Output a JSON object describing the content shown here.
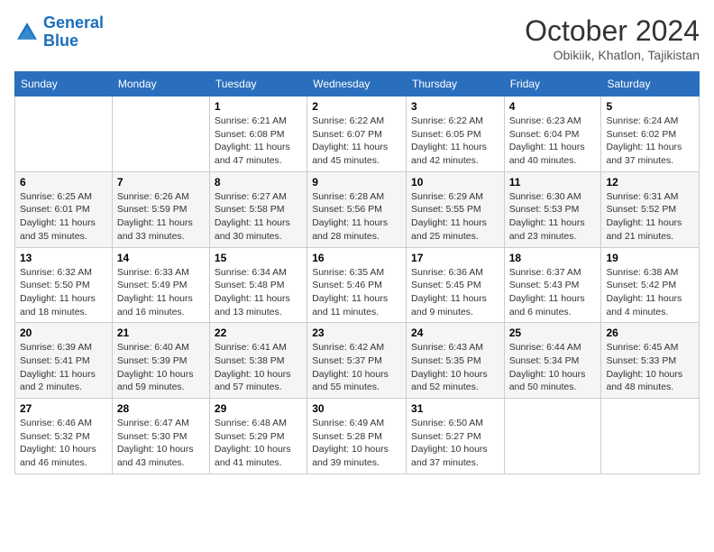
{
  "logo": {
    "line1": "General",
    "line2": "Blue"
  },
  "title": "October 2024",
  "location": "Obikiik, Khatlon, Tajikistan",
  "weekdays": [
    "Sunday",
    "Monday",
    "Tuesday",
    "Wednesday",
    "Thursday",
    "Friday",
    "Saturday"
  ],
  "weeks": [
    [
      {
        "day": "",
        "content": ""
      },
      {
        "day": "",
        "content": ""
      },
      {
        "day": "1",
        "content": "Sunrise: 6:21 AM\nSunset: 6:08 PM\nDaylight: 11 hours and 47 minutes."
      },
      {
        "day": "2",
        "content": "Sunrise: 6:22 AM\nSunset: 6:07 PM\nDaylight: 11 hours and 45 minutes."
      },
      {
        "day": "3",
        "content": "Sunrise: 6:22 AM\nSunset: 6:05 PM\nDaylight: 11 hours and 42 minutes."
      },
      {
        "day": "4",
        "content": "Sunrise: 6:23 AM\nSunset: 6:04 PM\nDaylight: 11 hours and 40 minutes."
      },
      {
        "day": "5",
        "content": "Sunrise: 6:24 AM\nSunset: 6:02 PM\nDaylight: 11 hours and 37 minutes."
      }
    ],
    [
      {
        "day": "6",
        "content": "Sunrise: 6:25 AM\nSunset: 6:01 PM\nDaylight: 11 hours and 35 minutes."
      },
      {
        "day": "7",
        "content": "Sunrise: 6:26 AM\nSunset: 5:59 PM\nDaylight: 11 hours and 33 minutes."
      },
      {
        "day": "8",
        "content": "Sunrise: 6:27 AM\nSunset: 5:58 PM\nDaylight: 11 hours and 30 minutes."
      },
      {
        "day": "9",
        "content": "Sunrise: 6:28 AM\nSunset: 5:56 PM\nDaylight: 11 hours and 28 minutes."
      },
      {
        "day": "10",
        "content": "Sunrise: 6:29 AM\nSunset: 5:55 PM\nDaylight: 11 hours and 25 minutes."
      },
      {
        "day": "11",
        "content": "Sunrise: 6:30 AM\nSunset: 5:53 PM\nDaylight: 11 hours and 23 minutes."
      },
      {
        "day": "12",
        "content": "Sunrise: 6:31 AM\nSunset: 5:52 PM\nDaylight: 11 hours and 21 minutes."
      }
    ],
    [
      {
        "day": "13",
        "content": "Sunrise: 6:32 AM\nSunset: 5:50 PM\nDaylight: 11 hours and 18 minutes."
      },
      {
        "day": "14",
        "content": "Sunrise: 6:33 AM\nSunset: 5:49 PM\nDaylight: 11 hours and 16 minutes."
      },
      {
        "day": "15",
        "content": "Sunrise: 6:34 AM\nSunset: 5:48 PM\nDaylight: 11 hours and 13 minutes."
      },
      {
        "day": "16",
        "content": "Sunrise: 6:35 AM\nSunset: 5:46 PM\nDaylight: 11 hours and 11 minutes."
      },
      {
        "day": "17",
        "content": "Sunrise: 6:36 AM\nSunset: 5:45 PM\nDaylight: 11 hours and 9 minutes."
      },
      {
        "day": "18",
        "content": "Sunrise: 6:37 AM\nSunset: 5:43 PM\nDaylight: 11 hours and 6 minutes."
      },
      {
        "day": "19",
        "content": "Sunrise: 6:38 AM\nSunset: 5:42 PM\nDaylight: 11 hours and 4 minutes."
      }
    ],
    [
      {
        "day": "20",
        "content": "Sunrise: 6:39 AM\nSunset: 5:41 PM\nDaylight: 11 hours and 2 minutes."
      },
      {
        "day": "21",
        "content": "Sunrise: 6:40 AM\nSunset: 5:39 PM\nDaylight: 10 hours and 59 minutes."
      },
      {
        "day": "22",
        "content": "Sunrise: 6:41 AM\nSunset: 5:38 PM\nDaylight: 10 hours and 57 minutes."
      },
      {
        "day": "23",
        "content": "Sunrise: 6:42 AM\nSunset: 5:37 PM\nDaylight: 10 hours and 55 minutes."
      },
      {
        "day": "24",
        "content": "Sunrise: 6:43 AM\nSunset: 5:35 PM\nDaylight: 10 hours and 52 minutes."
      },
      {
        "day": "25",
        "content": "Sunrise: 6:44 AM\nSunset: 5:34 PM\nDaylight: 10 hours and 50 minutes."
      },
      {
        "day": "26",
        "content": "Sunrise: 6:45 AM\nSunset: 5:33 PM\nDaylight: 10 hours and 48 minutes."
      }
    ],
    [
      {
        "day": "27",
        "content": "Sunrise: 6:46 AM\nSunset: 5:32 PM\nDaylight: 10 hours and 46 minutes."
      },
      {
        "day": "28",
        "content": "Sunrise: 6:47 AM\nSunset: 5:30 PM\nDaylight: 10 hours and 43 minutes."
      },
      {
        "day": "29",
        "content": "Sunrise: 6:48 AM\nSunset: 5:29 PM\nDaylight: 10 hours and 41 minutes."
      },
      {
        "day": "30",
        "content": "Sunrise: 6:49 AM\nSunset: 5:28 PM\nDaylight: 10 hours and 39 minutes."
      },
      {
        "day": "31",
        "content": "Sunrise: 6:50 AM\nSunset: 5:27 PM\nDaylight: 10 hours and 37 minutes."
      },
      {
        "day": "",
        "content": ""
      },
      {
        "day": "",
        "content": ""
      }
    ]
  ]
}
